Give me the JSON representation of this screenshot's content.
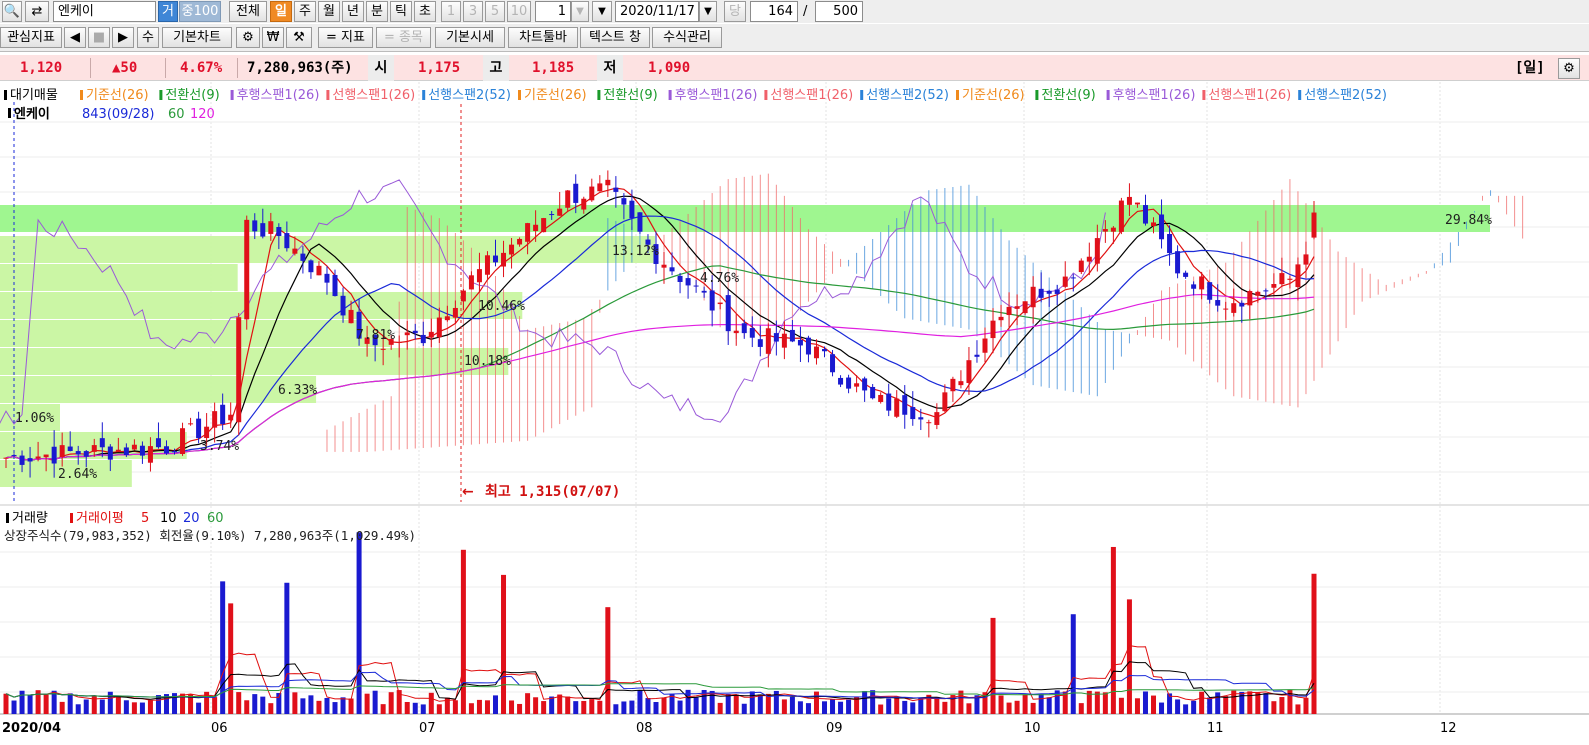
{
  "toolbar1": {
    "stock_name": "엔케이",
    "tag_geo": "거",
    "tag_jung": "중100",
    "btn_all": "전체",
    "btn_day": "일",
    "btn_week": "주",
    "btn_month": "월",
    "btn_year": "년",
    "btn_min": "분",
    "btn_tick": "틱",
    "btn_sec": "초",
    "btn_1": "1",
    "btn_3": "3",
    "btn_5": "5",
    "btn_10": "10",
    "period_value": "1",
    "date": "2020/11/17",
    "dang": "당",
    "count_value": "164",
    "slash": "/",
    "total_value": "500"
  },
  "toolbar2": {
    "interest": "관심지표",
    "su": "수",
    "basic_chart": "기본차트",
    "won": "₩",
    "indicator": "= 지표",
    "jongmok": "= 종목",
    "basic_quote": "기본시세",
    "chart_toolbar": "차트툴바",
    "text_window": "텍스트 창",
    "formula_mgmt": "수식관리"
  },
  "quote": {
    "price": "1,120",
    "change": "▲50",
    "pct": "4.67%",
    "volume": "7,280,963(주)",
    "open_label": "시",
    "open": "1,175",
    "high_label": "고",
    "high": "1,185",
    "low_label": "저",
    "low": "1,090",
    "period_tag": "[일]"
  },
  "price_panel": {
    "legend_prefix": "대기매물",
    "legend_items": [
      {
        "label": "기준선(26)",
        "color": "#f08a1c"
      },
      {
        "label": "전환선(9)",
        "color": "#1a9a2a"
      },
      {
        "label": "후행스팬1(26)",
        "color": "#9a5ad8"
      },
      {
        "label": "선행스팬1(26)",
        "color": "#f0606a"
      },
      {
        "label": "선행스팬2(52)",
        "color": "#2a82d8"
      },
      {
        "label": "기준선(26)",
        "color": "#f08a1c"
      },
      {
        "label": "전환선(9)",
        "color": "#1a9a2a"
      },
      {
        "label": "후행스팬1(26)",
        "color": "#9a5ad8"
      },
      {
        "label": "선행스팬1(26)",
        "color": "#f0606a"
      },
      {
        "label": "선행스팬2(52)",
        "color": "#2a82d8"
      },
      {
        "label": "기준선(26)",
        "color": "#f08a1c"
      },
      {
        "label": "전환선(9)",
        "color": "#1a9a2a"
      },
      {
        "label": "후행스팬1(26)",
        "color": "#9a5ad8"
      },
      {
        "label": "선행스팬1(26)",
        "color": "#f0606a"
      },
      {
        "label": "선행스팬2(52)",
        "color": "#2a82d8"
      }
    ],
    "ma_legend_name": "엔케이",
    "ma_legend_tail": "843(09/28)",
    "ma_legend_60": "60",
    "ma_legend_120": "120"
  },
  "volume_panel": {
    "legend_prefix": "거래량",
    "legend_name": "거래이평",
    "legend_5": "5",
    "legend_10": "10",
    "legend_20": "20",
    "legend_60": "60",
    "stats_text": "상장주식수(79,983,352) 회전율(9.10%) 7,280,963주(1,029.49%)"
  },
  "chart_data": {
    "type": "candlestick",
    "title": "엔케이",
    "x_tick_labels": [
      "2020/04",
      "06",
      "07",
      "08",
      "09",
      "10",
      "11",
      "12"
    ],
    "high_annotation": "최고 1,315(07/07)",
    "overhang_bands": [
      {
        "label": "29.84%",
        "pct": 29.84
      },
      {
        "label": "13.12%",
        "pct": 13.12
      },
      {
        "label": "4.76%",
        "pct": 4.76
      },
      {
        "label": "10.46%",
        "pct": 10.46
      },
      {
        "label": "7.81%",
        "pct": 7.81
      },
      {
        "label": "10.18%",
        "pct": 10.18
      },
      {
        "label": "6.33%",
        "pct": 6.33
      },
      {
        "label": "1.06%",
        "pct": 1.06
      },
      {
        "label": "3.74%",
        "pct": 3.74
      },
      {
        "label": "2.64%",
        "pct": 2.64
      }
    ],
    "last_candle": {
      "open": 1175,
      "high": 1185,
      "low": 1090,
      "close": 1120,
      "change": 50,
      "change_pct": 4.67,
      "volume": 7280963
    },
    "all_time_high": {
      "value": 1315,
      "date": "07/07"
    },
    "listed_shares": 79983352,
    "turnover_pct": 9.1,
    "volume_ratio_pct": 1029.49,
    "colors": {
      "up": "#e0101a",
      "down": "#1a1ad0",
      "band": "#a8f078",
      "band_top": "#88e878",
      "cloud_red": "#f06a6a",
      "cloud_blue": "#3a8ad8",
      "ma5": "#e01010",
      "ma10": "#000000",
      "ma20": "#1a2ad8",
      "ma60": "#2a9a3a",
      "ma120": "#e020e0"
    }
  }
}
